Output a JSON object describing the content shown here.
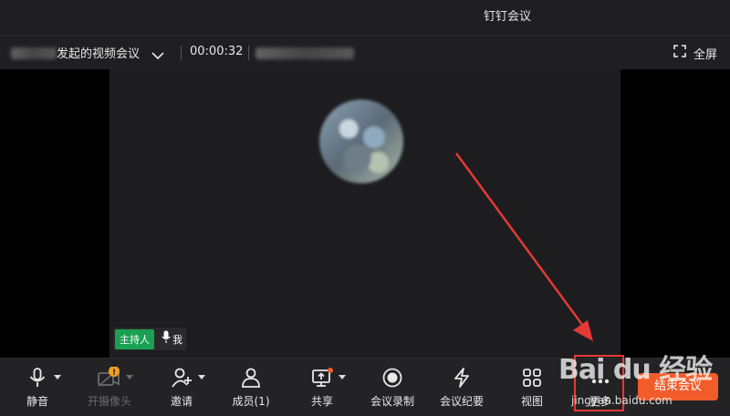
{
  "window": {
    "title": "钉钉会议"
  },
  "infobar": {
    "meeting_title": "发起的视频会议",
    "timer": "00:00:32",
    "fullscreen_label": "全屏"
  },
  "stage": {
    "host_badge": "主持人",
    "participant_name": "我"
  },
  "toolbar": {
    "items": [
      {
        "label": "静音",
        "icon": "microphone-icon"
      },
      {
        "label": "开摄像头",
        "icon": "camera-off-icon"
      },
      {
        "label": "邀请",
        "icon": "add-user-icon"
      },
      {
        "label": "成员(1)",
        "icon": "members-icon"
      },
      {
        "label": "共享",
        "icon": "screen-share-icon"
      },
      {
        "label": "会议录制",
        "icon": "record-icon"
      },
      {
        "label": "会议纪要",
        "icon": "lightning-icon"
      },
      {
        "label": "视图",
        "icon": "grid-view-icon"
      },
      {
        "label": "更多",
        "icon": "more-icon"
      }
    ],
    "end_label": "结束会议"
  },
  "watermark": {
    "top": "Bai du 经验",
    "bottom": "jingyan.baidu.com"
  },
  "colors": {
    "end_button": "#f25c2a",
    "host_badge": "#1aa053",
    "annotation": "#e53935"
  }
}
